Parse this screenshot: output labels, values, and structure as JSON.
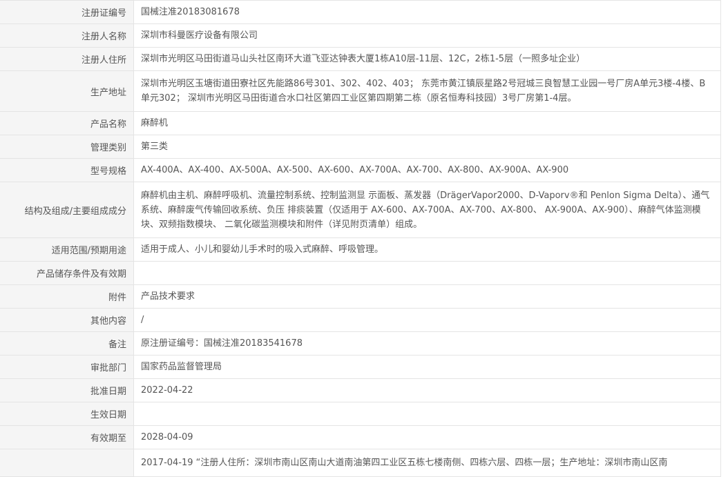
{
  "rows": [
    {
      "label": "注册证编号",
      "value": "国械注准20183081678"
    },
    {
      "label": "注册人名称",
      "value": "深圳市科曼医疗设备有限公司"
    },
    {
      "label": "注册人住所",
      "value": "深圳市光明区马田街道马山头社区南环大道飞亚达钟表大厦1栋A10层-11层、12C，2栋1-5层（一照多址企业）"
    },
    {
      "label": "生产地址",
      "value": "深圳市光明区玉塘街道田寮社区先能路86号301、302、402、403； 东莞市黄江镇辰星路2号冠城三良智慧工业园一号厂房A单元3楼-4楼、B单元302； 深圳市光明区马田街道合水口社区第四工业区第四期第二栋（原名恒寿科技园）3号厂房第1-4层。"
    },
    {
      "label": "产品名称",
      "value": "麻醉机"
    },
    {
      "label": "管理类别",
      "value": "第三类"
    },
    {
      "label": "型号规格",
      "value": "AX-400A、AX-400、AX-500A、AX-500、AX-600、AX-700A、AX-700、AX-800、AX-900A、AX-900"
    },
    {
      "label": "结构及组成/主要组成成分",
      "value": "麻醉机由主机、麻醉呼吸机、流量控制系统、控制监测显 示面板、蒸发器（DrägerVapor2000、D-Vaporv®和 Penlon Sigma Delta）、通气系统、麻醉废气传输回收系统、负压 排痰装置（仅适用于 AX-600、AX-700A、AX-700、AX-800、 AX-900A、AX-900）、麻醉气体监测模块、双频指数模块、 二氧化碳监测模块和附件（详见附页清单）组成。"
    },
    {
      "label": "适用范围/预期用途",
      "value": "适用于成人、小儿和婴幼儿手术时的吸入式麻醉、呼吸管理。"
    },
    {
      "label": "产品储存条件及有效期",
      "value": ""
    },
    {
      "label": "附件",
      "value": "产品技术要求"
    },
    {
      "label": "其他内容",
      "value": "/"
    },
    {
      "label": "备注",
      "value": "原注册证编号：国械注准20183541678"
    },
    {
      "label": "审批部门",
      "value": "国家药品监督管理局"
    },
    {
      "label": "批准日期",
      "value": "2022-04-22"
    },
    {
      "label": "生效日期",
      "value": ""
    },
    {
      "label": "有效期至",
      "value": "2028-04-09"
    },
    {
      "label": "",
      "value": "2017-04-19 “注册人住所：深圳市南山区南山大道南油第四工业区五栋七楼南侧、四栋六层、四栋一层；生产地址：深圳市南山区南"
    }
  ]
}
